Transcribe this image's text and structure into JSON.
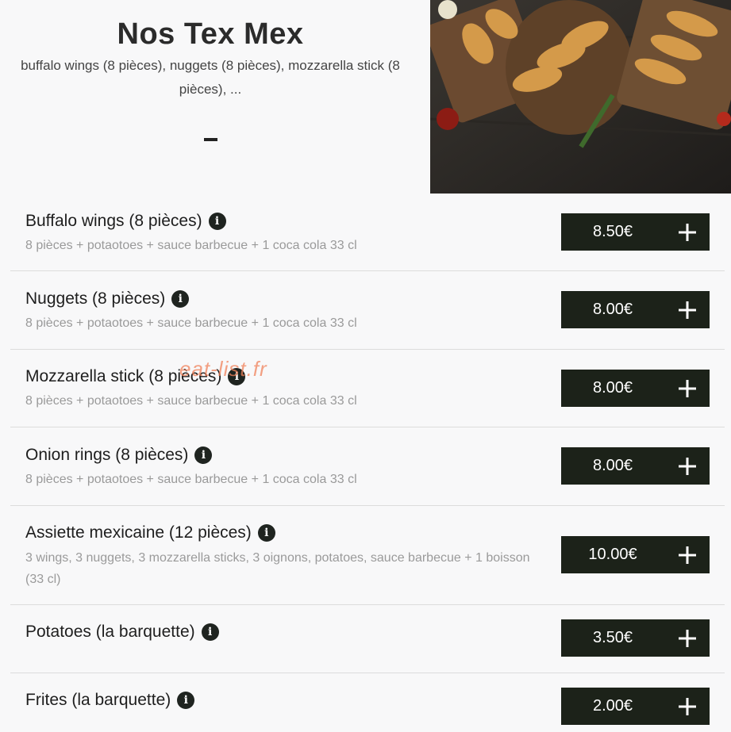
{
  "header": {
    "title": "Nos Tex Mex",
    "subtitle": "buffalo wings (8 pièces), nuggets (8 pièces), mozzarella stick (8 pièces), ..."
  },
  "items": [
    {
      "name": "Buffalo wings (8 pièces)",
      "description": "8 pièces + potaotoes + sauce barbecue + 1 coca cola 33 cl",
      "price": "8.50€"
    },
    {
      "name": "Nuggets (8 pièces)",
      "description": "8 pièces + potaotoes + sauce barbecue + 1 coca cola 33 cl",
      "price": "8.00€"
    },
    {
      "name": "Mozzarella stick (8 pièces)",
      "description": "8 pièces + potaotoes + sauce barbecue + 1 coca cola 33 cl",
      "price": "8.00€"
    },
    {
      "name": "Onion rings (8 pièces)",
      "description": "8 pièces + potaotoes + sauce barbecue + 1 coca cola 33 cl",
      "price": "8.00€"
    },
    {
      "name": "Assiette mexicaine (12 pièces)",
      "description": "3 wings, 3 nuggets, 3 mozzarella sticks, 3 oignons, potatoes, sauce barbecue + 1 boisson (33 cl)",
      "price": "10.00€"
    },
    {
      "name": "Potatoes (la barquette)",
      "description": "",
      "price": "3.50€"
    },
    {
      "name": "Frites (la barquette)",
      "description": "",
      "price": "2.00€"
    }
  ],
  "watermark": "eat-list.fr",
  "icons": {
    "info": "info-icon",
    "add": "plus-icon"
  },
  "colors": {
    "button_bg": "#1c2219",
    "background": "#f8f8f9",
    "description": "#9a9a9a"
  }
}
